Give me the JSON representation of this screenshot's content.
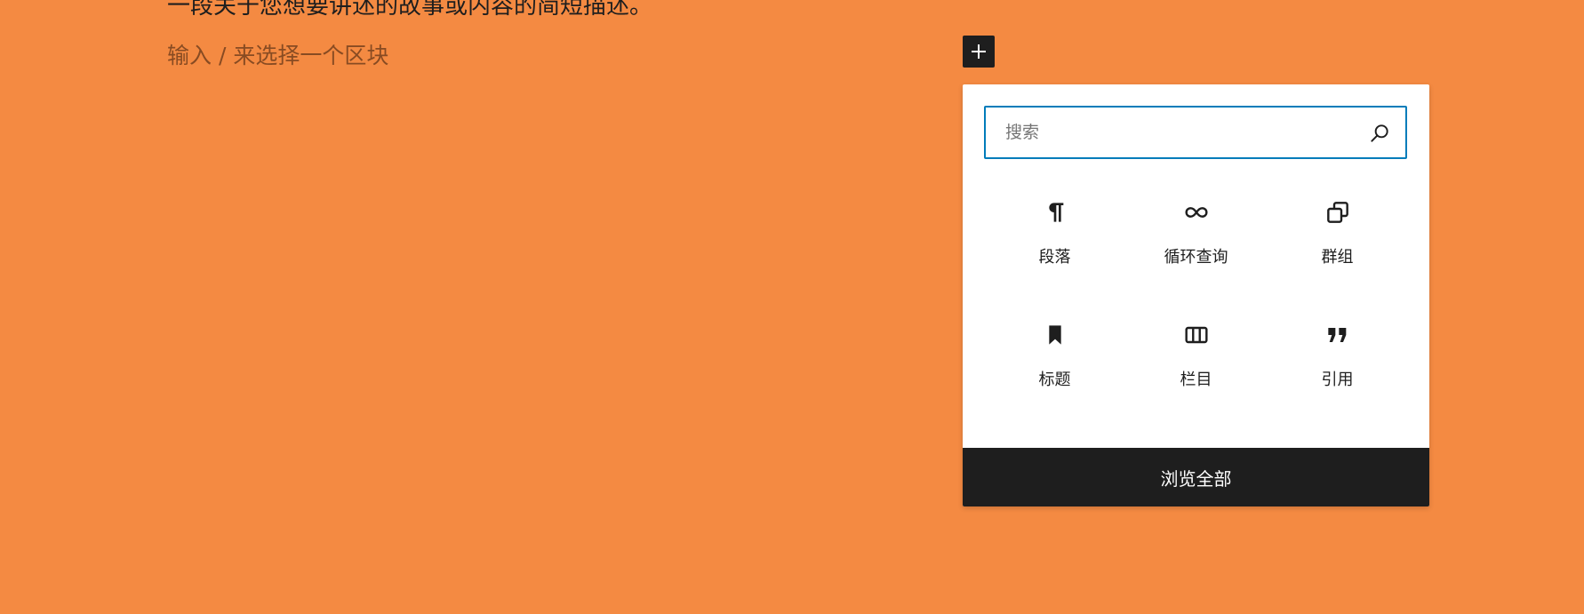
{
  "editor": {
    "clipped_top_text": "一段关于您想要讲述的故事或内容的简短描述。",
    "placeholder": "输入 / 来选择一个区块"
  },
  "colors": {
    "canvas_background": "#F48A42",
    "accent_focus": "#007cba",
    "dark": "#1e1e1e"
  },
  "inserter": {
    "toggle_icon": "plus-icon",
    "search": {
      "placeholder": "搜索",
      "value": "",
      "icon": "search-icon"
    },
    "blocks": [
      {
        "label": "段落",
        "icon": "paragraph-icon"
      },
      {
        "label": "循环查询",
        "icon": "loop-icon"
      },
      {
        "label": "群组",
        "icon": "group-icon"
      },
      {
        "label": "标题",
        "icon": "bookmark-icon"
      },
      {
        "label": "栏目",
        "icon": "columns-icon"
      },
      {
        "label": "引用",
        "icon": "quote-icon"
      }
    ],
    "browse_all_label": "浏览全部"
  }
}
